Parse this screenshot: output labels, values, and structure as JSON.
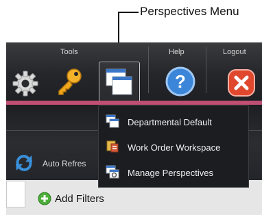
{
  "callout": {
    "label": "Perspectives Menu"
  },
  "toolbar": {
    "tools_label": "Tools",
    "help_label": "Help",
    "logout_label": "Logout"
  },
  "icons": {
    "settings": "gear-icon",
    "key": "key-icon",
    "perspectives": "windows-stack-icon",
    "help": "question-icon",
    "logout": "close-icon",
    "refresh": "refresh-arrows-icon",
    "add": "plus-circle-icon"
  },
  "refresh": {
    "label": "Auto Refres"
  },
  "filters": {
    "add_label": "Add Filters"
  },
  "perspectives_menu": {
    "items": [
      {
        "label": "Departmental Default",
        "icon": "windows-stack-icon"
      },
      {
        "label": "Work Order Workspace",
        "icon": "workspace-icon"
      },
      {
        "label": "Manage Perspectives",
        "icon": "manage-windows-icon"
      }
    ]
  },
  "colors": {
    "toolbar_bg": "#25262a",
    "accent_band": "#c04f74",
    "help_blue": "#3b86d8",
    "logout_red": "#e0482e",
    "key_gold": "#f0a91c",
    "add_green": "#4caf3a"
  }
}
